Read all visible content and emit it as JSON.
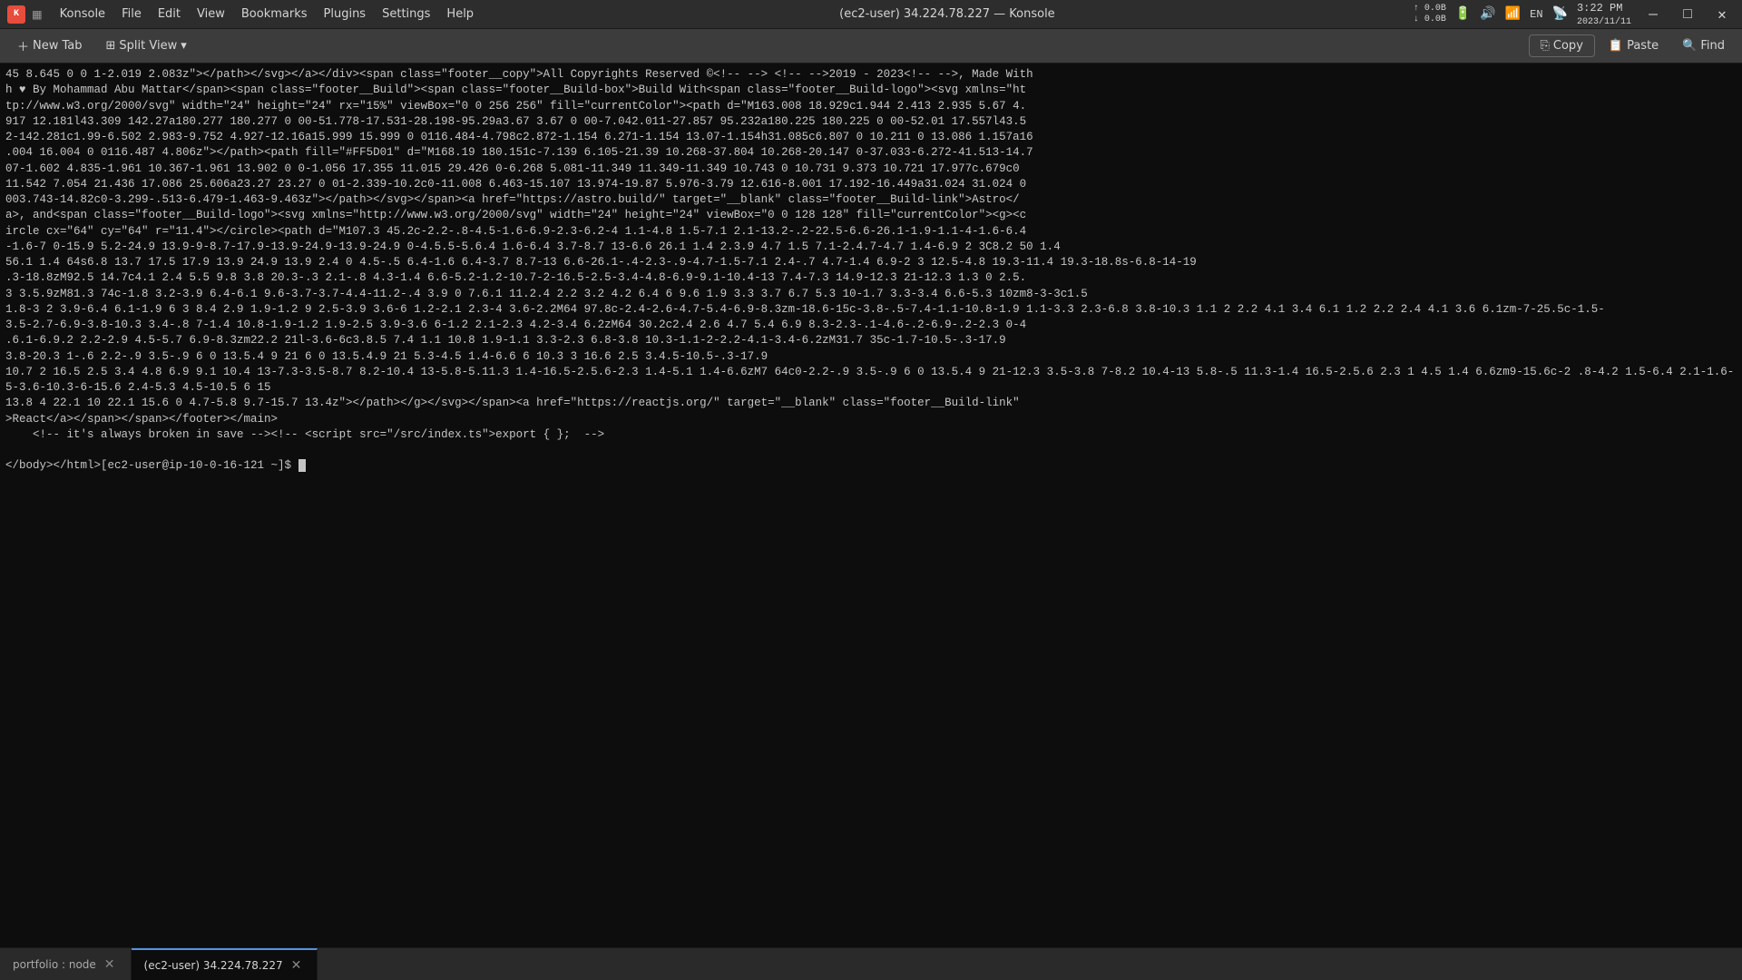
{
  "titlebar": {
    "app_icon": "K",
    "app_name": "Konsole",
    "menus": [
      "File",
      "Edit",
      "View",
      "Bookmarks",
      "Plugins",
      "Settings",
      "Help"
    ],
    "window_title": "(ec2-user) 34.224.78.227 — Konsole",
    "sys_net_up": "0.0B",
    "sys_net_down": "0.0B",
    "time": "3:22 PM",
    "date": "2023/11/11"
  },
  "toolbar": {
    "new_tab_label": "New Tab",
    "split_view_label": "Split View",
    "copy_label": "Copy",
    "paste_label": "Paste",
    "find_label": "Find",
    "window_min_icon": "—",
    "window_max_icon": "□",
    "window_close_icon": "✕"
  },
  "terminal": {
    "content": "45 8.645 0 0 1-2.019 2.083z\"></path></svg></a></div><span class=\"footer__copy\">All Copyrights Reserved ©<!-- --> <!-- -->2019 - 2023<!-- -->, Made With\nh ♥ By Mohammad Abu Mattar</span><span class=\"footer__Build\"><span class=\"footer__Build-box\">Build With<span class=\"footer__Build-logo\"><svg xmlns=\"ht\ntp://www.w3.org/2000/svg\" width=\"24\" height=\"24\" rx=\"15%\" viewBox=\"0 0 256 256\" fill=\"currentColor\"><path d=\"M163.008 18.929c1.944 2.413 2.935 5.67 4.\n917 12.181l43.309 142.27a180.277 180.277 0 00-51.778-17.531-28.198-95.29a3.67 3.67 0 00-7.042.011-27.857 95.232a180.225 180.225 0 00-52.01 17.557l43.5\n2-142.281c1.99-6.502 2.983-9.752 4.927-12.16a15.999 15.999 0 0116.484-4.798c2.872-1.154 6.271-1.154 13.07-1.154h31.085c6.807 0 10.211 0 13.086 1.157a16\n.004 16.004 0 0116.487 4.806z\"></path><path fill=\"#FF5D01\" d=\"M168.19 180.151c-7.139 6.105-21.39 10.268-37.804 10.268-20.147 0-37.033-6.272-41.513-14.7\n07-1.602 4.835-1.961 10.367-1.961 13.902 0 0-1.056 17.355 11.015 29.426 0-6.268 5.081-11.349 11.349-11.349 10.743 0 10.731 9.373 10.721 17.977c.679c0\n11.542 7.054 21.436 17.086 25.606a23.27 23.27 0 01-2.339-10.2c0-11.008 6.463-15.107 13.974-19.87 5.976-3.79 12.616-8.001 17.192-16.449a31.024 31.024 0\n003.743-14.82c0-3.299-.513-6.479-1.463-9.463z\"></path></svg></span><a href=\"https://astro.build/\" target=\"__blank\" class=\"footer__Build-link\">Astro</\na>, and<span class=\"footer__Build-logo\"><svg xmlns=\"http://www.w3.org/2000/svg\" width=\"24\" height=\"24\" viewBox=\"0 0 128 128\" fill=\"currentColor\"><g><c\nircle cx=\"64\" cy=\"64\" r=\"11.4\"></circle><path d=\"M107.3 45.2c-2.2-.8-4.5-1.6-6.9-2.3-6.2-4 1.1-4.8 1.5-7.1 2.1-13.2-.2-22.5-6.6-26.1-1.9-1.1-4-1.6-6.4\n-1.6-7 0-15.9 5.2-24.9 13.9-9-8.7-17.9-13.9-24.9-13.9-24.9 0-4.5.5-5.6.4 1.6-6.4 3.7-8.7 13-6.6 26.1 1.4 2.3.9 4.7 1.5 7.1-2.4.7-4.7 1.4-6.9 2 3C8.2 50 1.4\n56.1 1.4 64s6.8 13.7 17.5 17.9 13.9 24.9 13.9 2.4 0 4.5-.5 6.4-1.6 6.4-3.7 8.7-13 6.6-26.1-.4-2.3-.9-4.7-1.5-7.1 2.4-.7 4.7-1.4 6.9-2 3 12.5-4.8 19.3-11.4 19.3-18.8s-6.8-14-19\n.3-18.8zM92.5 14.7c4.1 2.4 5.5 9.8 3.8 20.3-.3 2.1-.8 4.3-1.4 6.6-5.2-1.2-10.7-2-16.5-2.5-3.4-4.8-6.9-9.1-10.4-13 7.4-7.3 14.9-12.3 21-12.3 1.3 0 2.5.\n3 3.5.9zM81.3 74c-1.8 3.2-3.9 6.4-6.1 9.6-3.7-3.7-4.4-11.2-.4 3.9 0 7.6.1 11.2.4 2.2 3.2 4.2 6.4 6 9.6 1.9 3.3 3.7 6.7 5.3 10-1.7 3.3-3.4 6.6-5.3 10zm8-3-3c1.5\n1.8-3 2 3.9-6.4 6.1-1.9 6 3 8.4 2.9 1.9-1.2 9 2.5-3.9 3.6-6 1.2-2.1 2.3-4 3.6-2.2M64 97.8c-2.4-2.6-4.7-5.4-6.9-8.3zm-18.6-15c-3.8-.5-7.4-1.1-10.8-1.9 1.1-3.3 2.3-6.8 3.8-10.3 1.1 2 2.2 4.1 3.4 6.1 1.2 2.2 2.4 4.1 3.6 6.1zm-7-25.5c-1.5-\n3.5-2.7-6.9-3.8-10.3 3.4-.8 7-1.4 10.8-1.9-1.2 1.9-2.5 3.9-3.6 6-1.2 2.1-2.3 4.2-3.4 6.2zM64 30.2c2.4 2.6 4.7 5.4 6.9 8.3-2.3-.1-4.6-.2-6.9-.2-2.3 0-4\n.6.1-6.9.2 2.2-2.9 4.5-5.7 6.9-8.3zm22.2 21l-3.6-6c3.8.5 7.4 1.1 10.8 1.9-1.1 3.3-2.3 6.8-3.8 10.3-1.1-2-2.2-4.1-3.4-6.2zM31.7 35c-1.7-10.5-.3-17.9\n3.8-20.3 1-.6 2.2-.9 3.5-.9 6 0 13.5.4 9 21 6 0 13.5.4.9 21 5.3-4.5 1.4-6.6 6 10.3 3 16.6 2.5 3.4.5-10.5-.3-17.9\n10.7 2 16.5 2.5 3.4 4.8 6.9 9.1 10.4 13-7.3-3.5-8.7 8.2-10.4 13-5.8-5.11.3 1.4-16.5-2.5.6-2.3 1.4-5.1 1.4-6.6zM7 64c0-2.2-.9 3.5-.9 6 0 13.5.4 9 21-12.3 3.5-3.8 7-8.2 10.4-13 5.8-.5 11.3-1.4 16.5-2.5.6 2.3 1 4.5 1.4 6.6zm9-15.6c-2 .8-4.2 1.5-6.4 2.1-1.6-5-3.6-10.3-6-15.6 2.4-5.3 4.5-10.5 6 15\n13.8 4 22.1 10 22.1 15.6 0 4.7-5.8 9.7-15.7 13.4z\"></path></g></svg></span><a href=\"https://reactjs.org/\" target=\"__blank\" class=\"footer__Build-link\"\n>React</a></span></span></footer></main>\n    <!-- it's always broken in save --><!-- <script src=\"/src/index.ts\">export { };  -->\n\n</body></html>[ec2-user@ip-10-0-16-121 ~]$ "
  },
  "tabs": [
    {
      "label": "portfolio : node",
      "active": false
    },
    {
      "label": "(ec2-user) 34.224.78.227",
      "active": true
    }
  ],
  "tray": {
    "icons": [
      "🔋",
      "🔊",
      "EN",
      "WiFi"
    ]
  }
}
